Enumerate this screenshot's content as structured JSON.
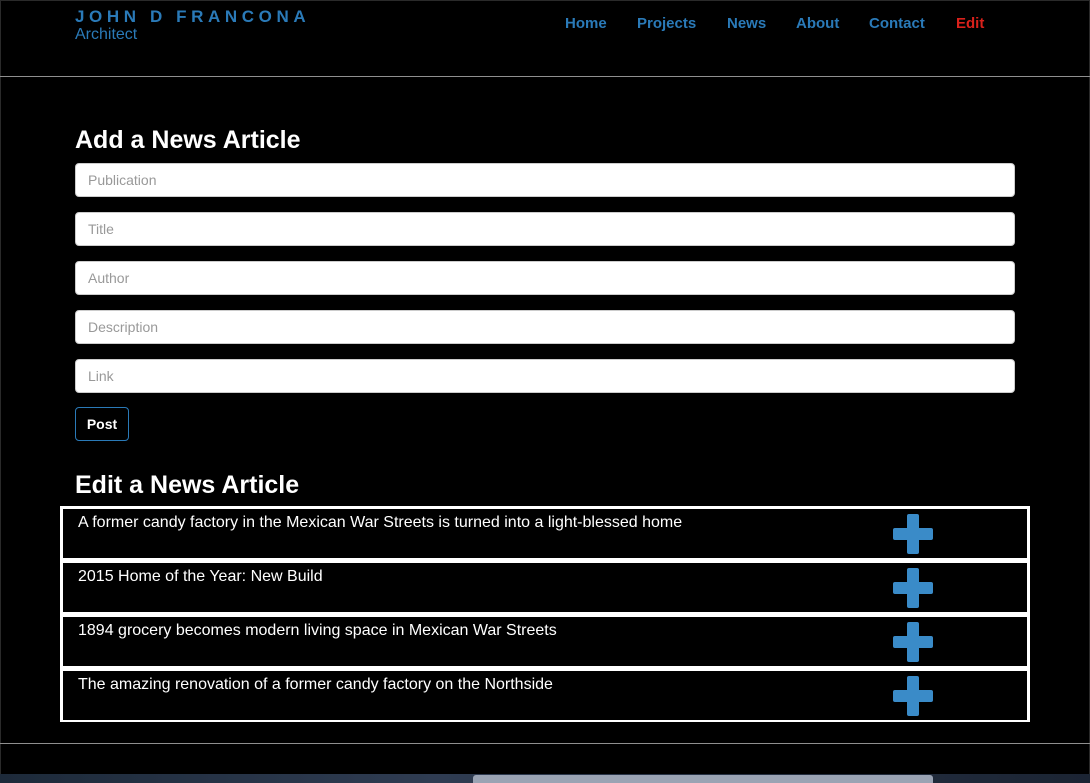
{
  "header": {
    "brand_name": "JOHN D FRANCONA",
    "brand_sub": "Architect",
    "nav": {
      "home": "Home",
      "projects": "Projects",
      "news": "News",
      "about": "About",
      "contact": "Contact",
      "edit": "Edit"
    }
  },
  "add_form": {
    "heading": "Add a News Article",
    "publication_placeholder": "Publication",
    "title_placeholder": "Title",
    "author_placeholder": "Author",
    "description_placeholder": "Description",
    "link_placeholder": "Link",
    "post_label": "Post"
  },
  "edit_section": {
    "heading": "Edit a News Article",
    "articles": [
      {
        "title": "A former candy factory in the Mexican War Streets is turned into a light-blessed home",
        "action_icon": "plus-icon"
      },
      {
        "title": "2015 Home of the Year: New Build",
        "action_icon": "plus-icon"
      },
      {
        "title": "1894 grocery becomes modern living space in Mexican War Streets",
        "action_icon": "plus-icon"
      },
      {
        "title": "The amazing renovation of a former candy factory on the Northside",
        "action_icon": "plus-icon"
      }
    ]
  },
  "colors": {
    "brand_blue": "#2a7ab8",
    "active_red": "#d9211b",
    "icon_blue": "#3a8bc8",
    "background": "#000000"
  }
}
